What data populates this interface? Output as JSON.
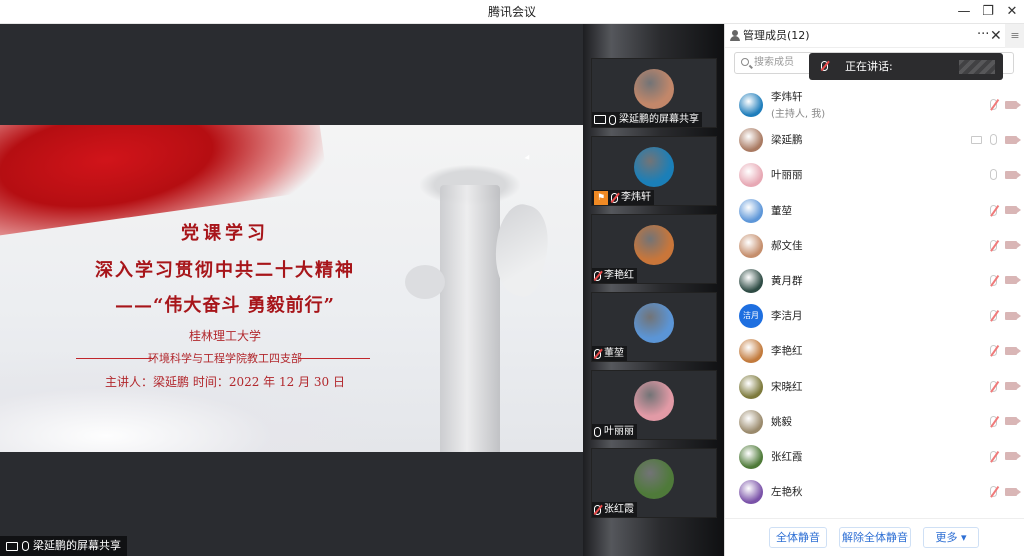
{
  "window": {
    "title": "腾讯会议",
    "minimize_icon": "minimize-icon",
    "restore_icon": "restore-icon",
    "close_icon": "close-icon"
  },
  "slide": {
    "line1": "党课学习",
    "line2": "深入学习贯彻中共二十大精神",
    "line3": "——“伟大奋斗 勇毅前行”",
    "line4": "桂林理工大学",
    "line5": "环境科学与工程学院教工四支部",
    "line6": "主讲人：梁延鹏    时间：2022 年 12 月 30 日"
  },
  "screen_share_label": "梁延鹏的屏幕共享",
  "video_tiles": [
    {
      "label": "梁延鹏的屏幕共享",
      "avatar_color": "#c2876a",
      "mic": "on",
      "screen": true,
      "host_badge": false
    },
    {
      "label": "李炜轩",
      "avatar_color": "#1b7fb8",
      "mic": "muted",
      "screen": false,
      "host_badge": true
    },
    {
      "label": "李艳红",
      "avatar_color": "#c9763a",
      "mic": "muted",
      "screen": false,
      "host_badge": false
    },
    {
      "label": "董堃",
      "avatar_color": "#5b95d6",
      "mic": "muted",
      "screen": false,
      "host_badge": false
    },
    {
      "label": "叶丽丽",
      "avatar_color": "#e29aa6",
      "mic": "on",
      "screen": false,
      "host_badge": false
    },
    {
      "label": "张红霞",
      "avatar_color": "#4f7a3a",
      "mic": "muted",
      "screen": false,
      "host_badge": false
    }
  ],
  "panel": {
    "title": "管理成员(12)",
    "more": "···",
    "close": "✕",
    "side": "≡",
    "search_placeholder": "搜索成员",
    "speaking_label": "正在讲话:",
    "members": [
      {
        "name": "李炜轩",
        "sub": "(主持人, 我)",
        "avatar_color": "#1e7dbb",
        "avatar_text": "",
        "mic": "muted",
        "screen": false
      },
      {
        "name": "梁延鹏",
        "sub": "",
        "avatar_color": "#a97a62",
        "avatar_text": "",
        "mic": "on",
        "screen": true
      },
      {
        "name": "叶丽丽",
        "sub": "",
        "avatar_color": "#e7a8b4",
        "avatar_text": "",
        "mic": "on",
        "screen": false
      },
      {
        "name": "董堃",
        "sub": "",
        "avatar_color": "#5d96d8",
        "avatar_text": "",
        "mic": "muted",
        "screen": false
      },
      {
        "name": "郝文佳",
        "sub": "",
        "avatar_color": "#c58e6c",
        "avatar_text": "",
        "mic": "muted",
        "screen": false
      },
      {
        "name": "黄月群",
        "sub": "",
        "avatar_color": "#2e4b44",
        "avatar_text": "",
        "mic": "muted",
        "screen": false
      },
      {
        "name": "李洁月",
        "sub": "",
        "avatar_color": "#1e6fe0",
        "avatar_text": "洁月",
        "mic": "muted",
        "screen": false
      },
      {
        "name": "李艳红",
        "sub": "",
        "avatar_color": "#c27a3c",
        "avatar_text": "",
        "mic": "muted",
        "screen": false
      },
      {
        "name": "宋晓红",
        "sub": "",
        "avatar_color": "#7d7a3c",
        "avatar_text": "",
        "mic": "muted",
        "screen": false
      },
      {
        "name": "姚毅",
        "sub": "",
        "avatar_color": "#9a8a6c",
        "avatar_text": "",
        "mic": "muted",
        "screen": false
      },
      {
        "name": "张红霞",
        "sub": "",
        "avatar_color": "#4e7a38",
        "avatar_text": "",
        "mic": "muted",
        "screen": false
      },
      {
        "name": "左艳秋",
        "sub": "",
        "avatar_color": "#7a52a8",
        "avatar_text": "",
        "mic": "muted",
        "screen": false
      }
    ],
    "footer": {
      "mute_all": "全体静音",
      "unmute_all": "解除全体静音",
      "more": "更多 ▾"
    }
  }
}
